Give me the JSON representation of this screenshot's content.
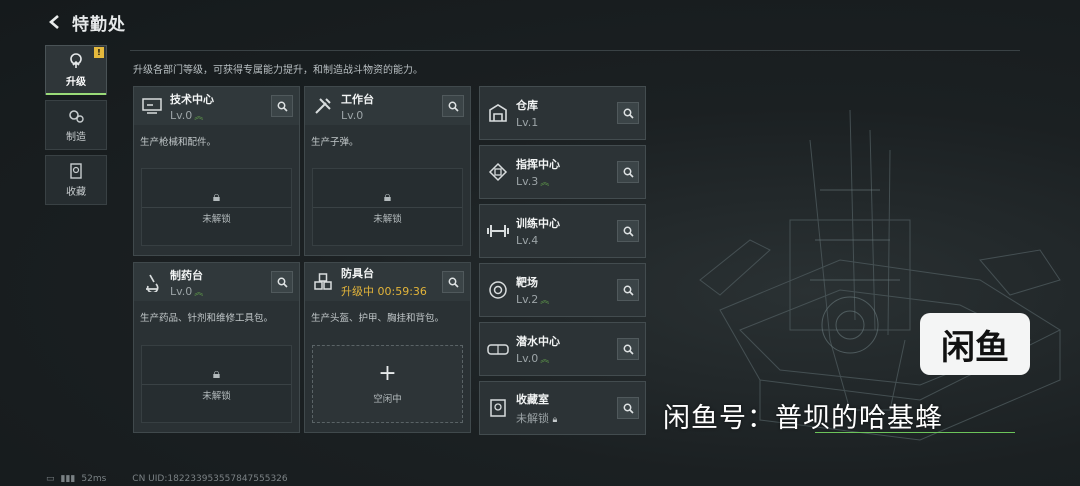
{
  "header": {
    "back_icon": "back-arrow-icon",
    "title": "特勤处"
  },
  "intro": "升级各部门等级，可获得专属能力提升，和制造战斗物资的能力。",
  "sidenav": [
    {
      "label": "升级",
      "icon": "upgrade-icon",
      "active": true,
      "badge": "!"
    },
    {
      "label": "制造",
      "icon": "gears-icon",
      "active": false
    },
    {
      "label": "收藏",
      "icon": "collection-icon",
      "active": false
    }
  ],
  "workshops": [
    {
      "name": "技术中心",
      "level": "Lv.0",
      "icon": "tech-center-icon",
      "desc": "生产枪械和配件。",
      "slot": "未解锁"
    },
    {
      "name": "工作台",
      "level": "Lv.0",
      "icon": "workbench-tools-icon",
      "desc": "生产子弹。",
      "slot": "未解锁"
    },
    {
      "name": "制药台",
      "level": "Lv.0",
      "icon": "microscope-icon",
      "desc": "生产药品、针剂和维修工具包。",
      "slot": "未解锁"
    },
    {
      "name": "防具台",
      "level": "升级中 00:59:36",
      "icon": "armor-cubes-icon",
      "desc": "生产头盔、护甲、胸挂和背包。",
      "slot": "空闲中"
    }
  ],
  "facilities": [
    {
      "name": "仓库",
      "level": "Lv.1",
      "icon": "warehouse-icon",
      "upgradable": false
    },
    {
      "name": "指挥中心",
      "level": "Lv.3",
      "icon": "chip-icon",
      "upgradable": true
    },
    {
      "name": "训练中心",
      "level": "Lv.4",
      "icon": "dumbbell-icon",
      "upgradable": false
    },
    {
      "name": "靶场",
      "level": "Lv.2",
      "icon": "target-icon",
      "upgradable": true
    },
    {
      "name": "潜水中心",
      "level": "Lv.0",
      "icon": "diving-goggles-icon",
      "upgradable": true
    },
    {
      "name": "收藏室",
      "level": "未解锁",
      "icon": "collection-room-icon",
      "locked": true
    }
  ],
  "statusbar": {
    "ping": "52ms",
    "uid": "CN UID:182233953557847555326"
  },
  "watermark": {
    "logo_text": "闲鱼",
    "text": "闲鱼号：普坝的哈基蜂"
  },
  "colors": {
    "accent_green": "#9adb78",
    "timer_yellow": "#e2b43a",
    "badge_yellow": "#e5b93d"
  }
}
